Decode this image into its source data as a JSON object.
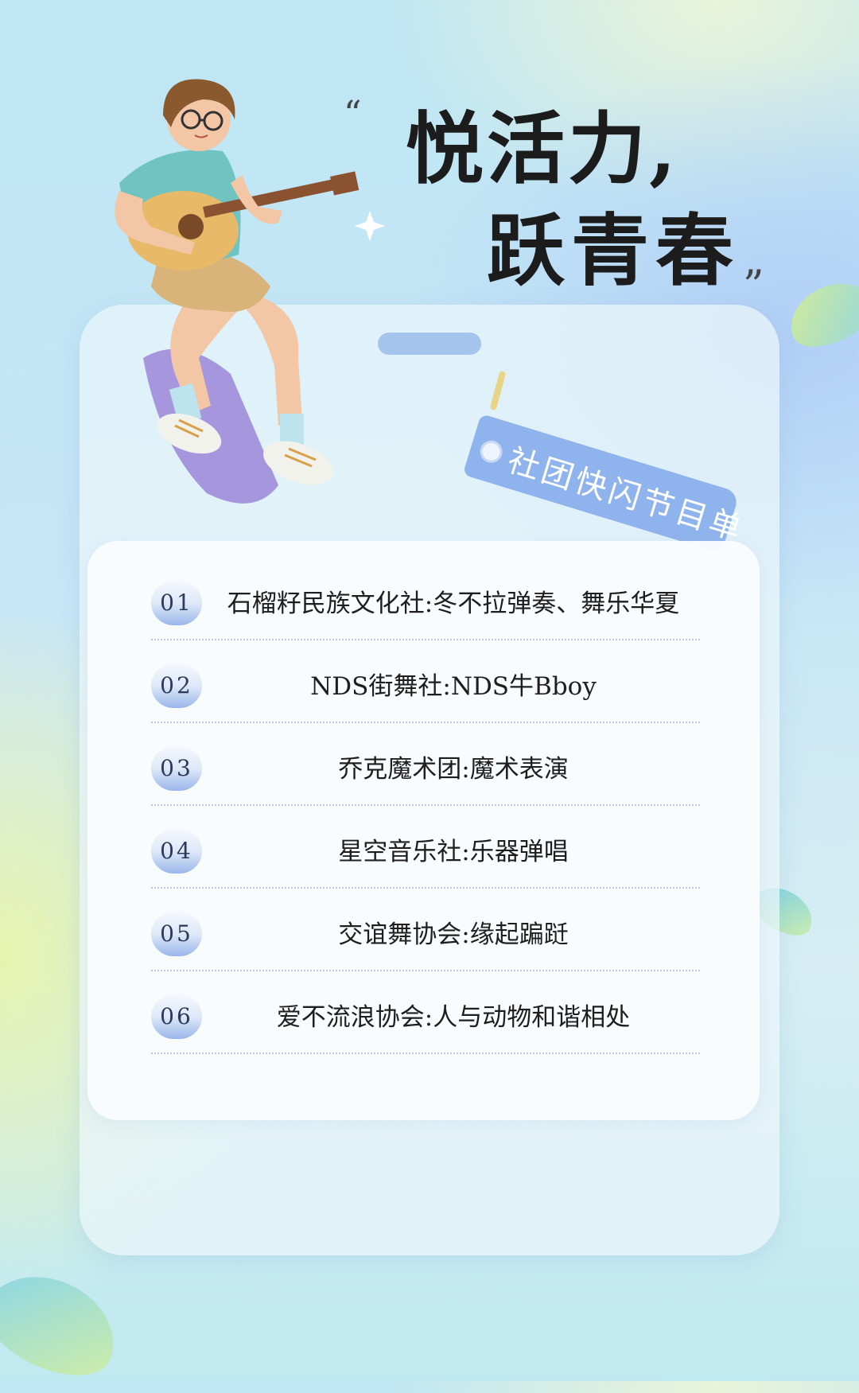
{
  "header": {
    "open_quote": "“",
    "close_quote": "”",
    "title_line1": "悦活力,",
    "title_line2": "跃青春"
  },
  "tag": {
    "label": "社团快闪节目单"
  },
  "program": [
    {
      "num": "01",
      "text": "石榴籽民族文化社:冬不拉弹奏、舞乐华夏"
    },
    {
      "num": "02",
      "text": "NDS街舞社:NDS牛Bboy"
    },
    {
      "num": "03",
      "text": "乔克魔术团:魔术表演"
    },
    {
      "num": "04",
      "text": "星空音乐社:乐器弹唱"
    },
    {
      "num": "05",
      "text": "交谊舞协会:缘起蹁跹"
    },
    {
      "num": "06",
      "text": "爱不流浪协会:人与动物和谐相处"
    }
  ],
  "illustration": {
    "icon": "guitarist-icon"
  },
  "colors": {
    "accent": "#8fb3ec",
    "title": "#1c1c1c",
    "badge_gradient_end": "#9ab7ea"
  }
}
